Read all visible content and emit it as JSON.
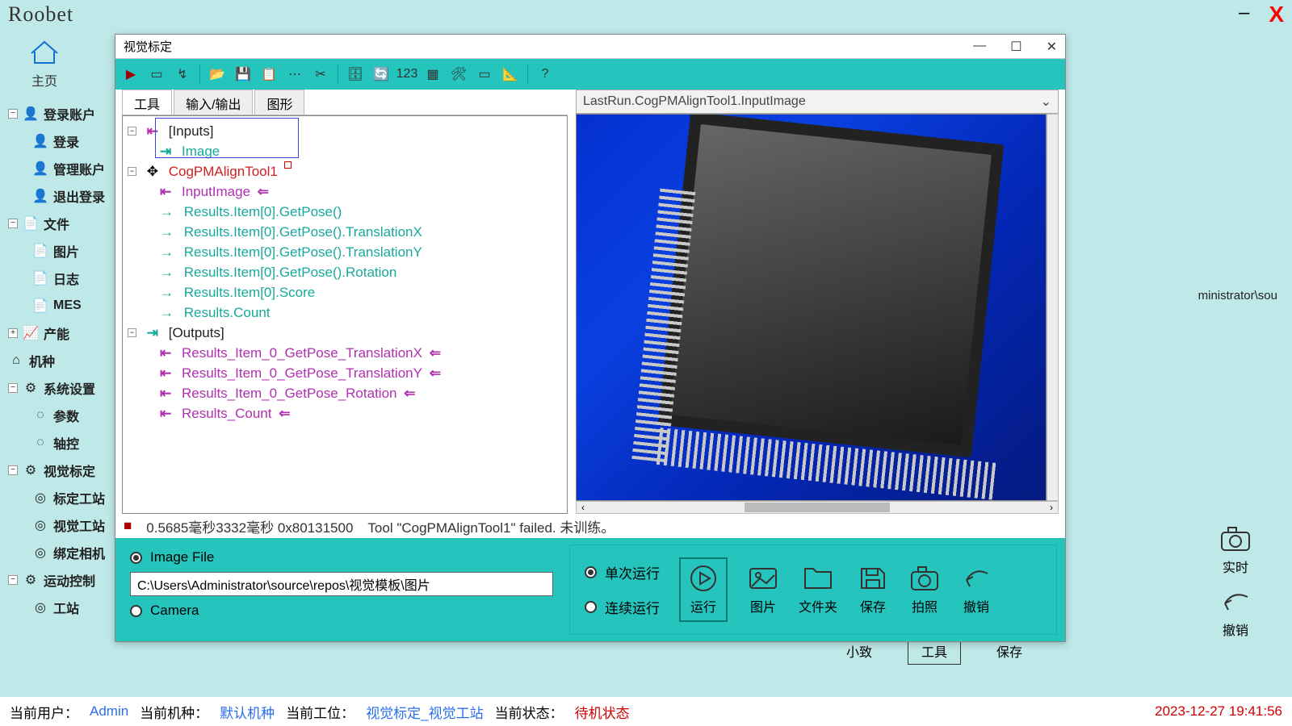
{
  "topbar": {
    "logo": "Roobet",
    "min": "–",
    "close": "X"
  },
  "home": {
    "label": "主页"
  },
  "nav": {
    "account": {
      "label": "登录账户",
      "login": "登录",
      "manage": "管理账户",
      "logout": "退出登录"
    },
    "file": {
      "label": "文件",
      "image": "图片",
      "log": "日志",
      "mes": "MES"
    },
    "capacity": "产能",
    "model": "机种",
    "settings": {
      "label": "系统设置",
      "params": "参数",
      "axis": "轴控"
    },
    "vision": {
      "label": "视觉标定",
      "calib": "标定工站",
      "vstation": "视觉工站",
      "bind": "绑定相机"
    },
    "motion": {
      "label": "运动控制",
      "station": "工站"
    }
  },
  "bg": {
    "path_frag": "ministrator\\sou",
    "b1": "小致",
    "b2": "工具",
    "b3": "保存"
  },
  "right_strip": {
    "realtime": "实时",
    "undo": "撤销"
  },
  "status": {
    "user_lbl": "当前用户：",
    "user": "Admin",
    "model_lbl": "当前机种：",
    "model": "默认机种",
    "station_lbl": "当前工位：",
    "station": "视觉标定_视觉工站",
    "state_lbl": "当前状态：",
    "state": "待机状态",
    "timestamp": "2023-12-27 19:41:56"
  },
  "dialog": {
    "title": "视觉标定",
    "tabs": {
      "tool": "工具",
      "io": "输入/输出",
      "graphic": "图形"
    },
    "tree": {
      "inputs": "[Inputs]",
      "image": "Image",
      "toolname": "CogPMAlignTool1",
      "input_image": "InputImage",
      "r_pose": "Results.Item[0].GetPose()",
      "r_tx": "Results.Item[0].GetPose().TranslationX",
      "r_ty": "Results.Item[0].GetPose().TranslationY",
      "r_rot": "Results.Item[0].GetPose().Rotation",
      "r_score": "Results.Item[0].Score",
      "r_count": "Results.Count",
      "outputs": "[Outputs]",
      "o_tx": "Results_Item_0_GetPose_TranslationX",
      "o_ty": "Results_Item_0_GetPose_TranslationY",
      "o_rot": "Results_Item_0_GetPose_Rotation",
      "o_count": "Results_Count"
    },
    "combo": "LastRun.CogPMAlignTool1.InputImage",
    "status_line": {
      "timing": "0.5685毫秒3332毫秒 0x80131500",
      "msg": "Tool \"CogPMAlignTool1\" failed. 未训练。"
    },
    "source": {
      "file_label": "Image File",
      "path": "C:\\Users\\Administrator\\source\\repos\\视觉模板\\图片",
      "camera_label": "Camera"
    },
    "run": {
      "single": "单次运行",
      "cont": "连续运行",
      "run": "运行",
      "image": "图片",
      "folder": "文件夹",
      "save": "保存",
      "photo": "拍照",
      "undo": "撤销"
    }
  }
}
